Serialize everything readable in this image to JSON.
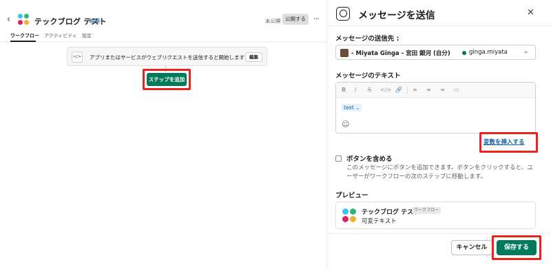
{
  "left": {
    "title": "テックブログ テスト",
    "edit_link": "編集",
    "status": "未公開",
    "publish_label": "公開する",
    "more_label": "···",
    "tabs": [
      {
        "label": "ワークフロー",
        "active": true
      },
      {
        "label": "アクティビティ",
        "active": false
      },
      {
        "label": "設定",
        "active": false
      }
    ],
    "trigger": {
      "icon": "code-icon",
      "text": "アプリまたはサービスがウェブリクエストを送信すると開始します",
      "edit_label": "編集"
    },
    "add_step_label": "ステップを追加"
  },
  "panel": {
    "title": "メッセージを送信",
    "recipient_label": "メッセージの送信先 :",
    "recipient_value": "- Miyata Ginga - 宮田 銀河 (自分)",
    "recipient_handle": "ginga.miyata",
    "text_label": "メッセージのテキスト",
    "toolbar": [
      "B",
      "I",
      "S",
      "</>",
      "🔗",
      "≡",
      "≡",
      "≡",
      "▭"
    ],
    "variable_chip": "text ⌄",
    "emoji_icon": "☺",
    "insert_variable_label": "変数を挿入する",
    "button_option_label": "ボタンを含める",
    "button_option_desc": "このメッセージにボタンを追加できます。ボタンをクリックすると、ユーザーがワークフローの次のステップに移動します。",
    "preview_label": "プレビュー",
    "preview_name": "テックブログ テスト",
    "preview_badge": "ワークフロー",
    "preview_text": "可変テキスト",
    "cancel_label": "キャンセル",
    "save_label": "保存する"
  },
  "colors": {
    "primary": "#007a5a",
    "link": "#1264a3",
    "highlight": "#e8231d"
  }
}
